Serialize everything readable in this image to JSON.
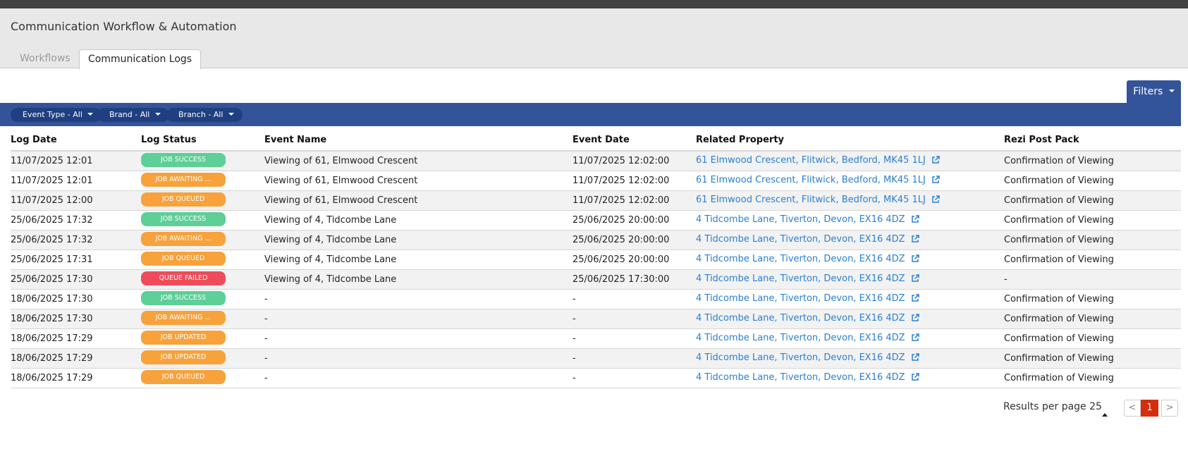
{
  "header": {
    "title": "Communication Workflow & Automation"
  },
  "tabs": [
    {
      "label": "Workflows"
    },
    {
      "label": "Communication Logs"
    }
  ],
  "filters": {
    "button_label": "Filters",
    "pills": [
      {
        "label": "Event Type - All"
      },
      {
        "label": "Brand - All"
      },
      {
        "label": "Branch - All"
      }
    ]
  },
  "colors": {
    "accent": "#335499",
    "link": "#2a7fd4",
    "status_success": "#5dcf97",
    "status_warn": "#f7a23b",
    "status_fail": "#ef4c59",
    "page_current": "#d32f0f"
  },
  "table": {
    "columns": [
      "Log Date",
      "Log Status",
      "Event Name",
      "Event Date",
      "Related Property",
      "Rezi Post Pack"
    ],
    "rows": [
      {
        "log_date": "11/07/2025 12:01",
        "status": "JOB SUCCESS",
        "status_kind": "success",
        "event_name": "Viewing of 61, Elmwood Crescent",
        "event_date": "11/07/2025 12:02:00",
        "property": "61 Elmwood Crescent, Flitwick, Bedford, MK45 1LJ",
        "post_pack": "Confirmation of Viewing"
      },
      {
        "log_date": "11/07/2025 12:01",
        "status": "JOB AWAITING ...",
        "status_kind": "warn",
        "event_name": "Viewing of 61, Elmwood Crescent",
        "event_date": "11/07/2025 12:02:00",
        "property": "61 Elmwood Crescent, Flitwick, Bedford, MK45 1LJ",
        "post_pack": "Confirmation of Viewing"
      },
      {
        "log_date": "11/07/2025 12:00",
        "status": "JOB QUEUED",
        "status_kind": "warn",
        "event_name": "Viewing of 61, Elmwood Crescent",
        "event_date": "11/07/2025 12:02:00",
        "property": "61 Elmwood Crescent, Flitwick, Bedford, MK45 1LJ",
        "post_pack": "Confirmation of Viewing"
      },
      {
        "log_date": "25/06/2025 17:32",
        "status": "JOB SUCCESS",
        "status_kind": "success",
        "event_name": "Viewing of 4, Tidcombe Lane",
        "event_date": "25/06/2025 20:00:00",
        "property": "4 Tidcombe Lane, Tiverton, Devon, EX16 4DZ",
        "post_pack": "Confirmation of Viewing"
      },
      {
        "log_date": "25/06/2025 17:32",
        "status": "JOB AWAITING ...",
        "status_kind": "warn",
        "event_name": "Viewing of 4, Tidcombe Lane",
        "event_date": "25/06/2025 20:00:00",
        "property": "4 Tidcombe Lane, Tiverton, Devon, EX16 4DZ",
        "post_pack": "Confirmation of Viewing"
      },
      {
        "log_date": "25/06/2025 17:31",
        "status": "JOB QUEUED",
        "status_kind": "warn",
        "event_name": "Viewing of 4, Tidcombe Lane",
        "event_date": "25/06/2025 20:00:00",
        "property": "4 Tidcombe Lane, Tiverton, Devon, EX16 4DZ",
        "post_pack": "Confirmation of Viewing"
      },
      {
        "log_date": "25/06/2025 17:30",
        "status": "QUEUE FAILED",
        "status_kind": "fail",
        "event_name": "Viewing of 4, Tidcombe Lane",
        "event_date": "25/06/2025 17:30:00",
        "property": "4 Tidcombe Lane, Tiverton, Devon, EX16 4DZ",
        "post_pack": "-"
      },
      {
        "log_date": "18/06/2025 17:30",
        "status": "JOB SUCCESS",
        "status_kind": "success",
        "event_name": "-",
        "event_date": "-",
        "property": "4 Tidcombe Lane, Tiverton, Devon, EX16 4DZ",
        "post_pack": "Confirmation of Viewing"
      },
      {
        "log_date": "18/06/2025 17:30",
        "status": "JOB AWAITING ...",
        "status_kind": "warn",
        "event_name": "-",
        "event_date": "-",
        "property": "4 Tidcombe Lane, Tiverton, Devon, EX16 4DZ",
        "post_pack": "Confirmation of Viewing"
      },
      {
        "log_date": "18/06/2025 17:29",
        "status": "JOB UPDATED",
        "status_kind": "warn",
        "event_name": "-",
        "event_date": "-",
        "property": "4 Tidcombe Lane, Tiverton, Devon, EX16 4DZ",
        "post_pack": "Confirmation of Viewing"
      },
      {
        "log_date": "18/06/2025 17:29",
        "status": "JOB UPDATED",
        "status_kind": "warn",
        "event_name": "-",
        "event_date": "-",
        "property": "4 Tidcombe Lane, Tiverton, Devon, EX16 4DZ",
        "post_pack": "Confirmation of Viewing"
      },
      {
        "log_date": "18/06/2025 17:29",
        "status": "JOB QUEUED",
        "status_kind": "warn",
        "event_name": "-",
        "event_date": "-",
        "property": "4 Tidcombe Lane, Tiverton, Devon, EX16 4DZ",
        "post_pack": "Confirmation of Viewing"
      }
    ]
  },
  "pagination": {
    "results_per_page_label": "Results per page 25",
    "prev_label": "<",
    "current_page": "1",
    "next_label": ">"
  }
}
